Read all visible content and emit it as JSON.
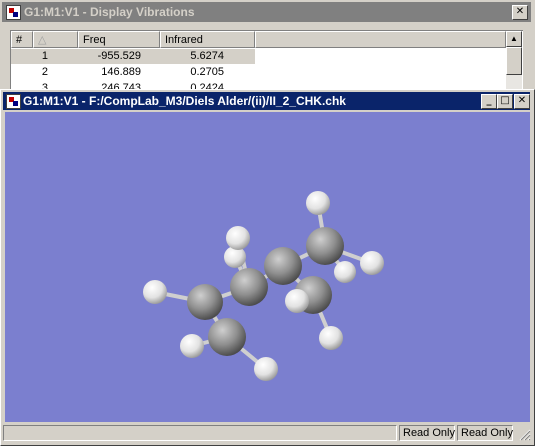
{
  "vibrations_window": {
    "title": "G1:M1:V1 - Display Vibrations",
    "close_glyph": "✕",
    "columns": [
      "#",
      "Freq",
      "Infrared"
    ],
    "sort_indicator": "△",
    "rows": [
      {
        "index": "1",
        "freq": "-955.529",
        "infrared": "5.6274"
      },
      {
        "index": "2",
        "freq": "146.889",
        "infrared": "0.2705"
      },
      {
        "index": "3",
        "freq": "246.743",
        "infrared": "0.2424"
      }
    ],
    "selected_row": 1
  },
  "molecule_window": {
    "title": "G1:M1:V1 - F:/CompLab_M3/Diels Alder/(ii)/II_2_CHK.chk",
    "controls": {
      "minimize": "_",
      "maximize": "□",
      "close": "✕"
    },
    "viewport_background": "#7b7fcf",
    "status": {
      "pane1": "Read Only",
      "pane2": "Read Only"
    }
  },
  "colors": {
    "carbon": "#8a8a8a",
    "hydrogen": "#e8e8e8",
    "bond": "#c8c8c8",
    "active_title": "#0a246a",
    "inactive_title": "#808080"
  }
}
